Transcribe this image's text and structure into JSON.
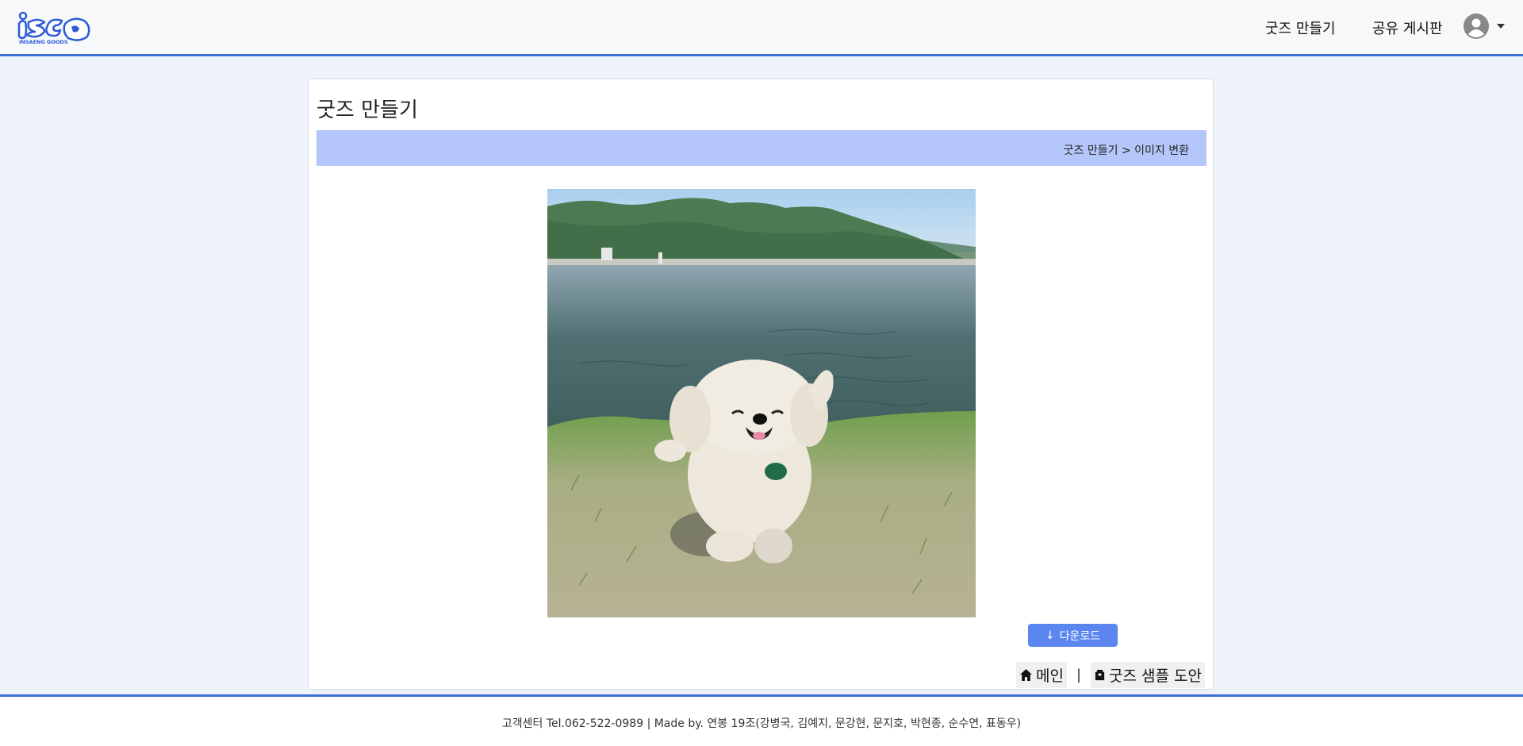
{
  "header": {
    "logo_text": "iSGD",
    "logo_subtext": "INSAENG GOODS",
    "nav": [
      {
        "label": "굿즈 만들기"
      },
      {
        "label": "공유 게시판"
      }
    ],
    "avatar_icon": "user-circle-icon",
    "accent": "#3d6fd6"
  },
  "main": {
    "title": "굿즈 만들기",
    "breadcrumb": "굿즈 만들기 > 이미지 변환",
    "breadcrumb_bg": "#b5c7fa",
    "image_alt": "cartoonized photo of a fluffy white dog toy dancing on grass by a lake",
    "download_label": "다운로드",
    "download_icon": "arrow-down-icon",
    "links": [
      {
        "label": "메인",
        "icon": "home-icon"
      },
      {
        "label": "굿즈 샘플 도안",
        "icon": "package-icon"
      }
    ],
    "link_separator": "|"
  },
  "footer": {
    "text": "고객센터 Tel.062-522-0989 | Made by. 연봉 19조(강병국, 김예지, 문강현, 문지호, 박현종, 순수연, 표동우)"
  }
}
